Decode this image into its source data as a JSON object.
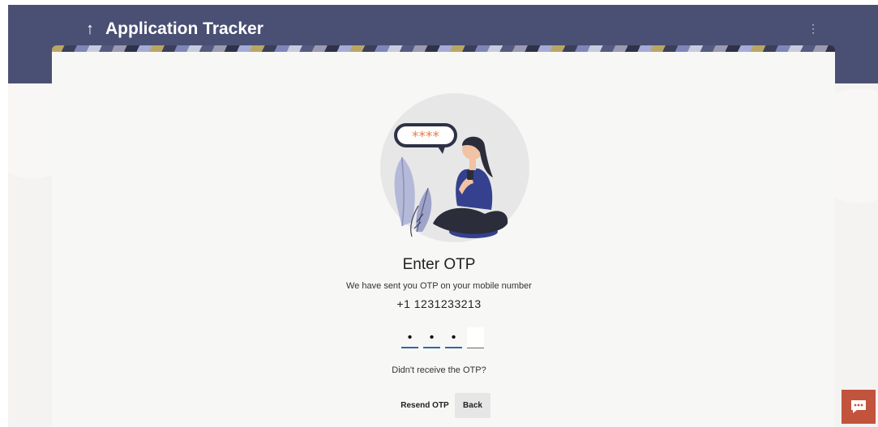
{
  "header": {
    "back_icon": "up-arrow-icon",
    "title": "Application Tracker",
    "menu_icon": "kebab-menu-icon"
  },
  "otp": {
    "title": "Enter OTP",
    "subtitle": "We have sent you OTP on your mobile number",
    "phone": "+1 1231233213",
    "digits": [
      "•",
      "•",
      "•",
      ""
    ],
    "not_received": "Didn't receive the OTP?",
    "illustration_bubble": "****"
  },
  "actions": {
    "resend_label": "Resend OTP",
    "back_label": "Back"
  },
  "chat": {
    "icon": "chat-bubble-icon"
  },
  "colors": {
    "header_bg": "#4a5073",
    "accent": "#2f6aa3",
    "chat_bg": "#c2533d",
    "illustration_orange": "#e97b4b",
    "illustration_blue": "#35418f"
  }
}
